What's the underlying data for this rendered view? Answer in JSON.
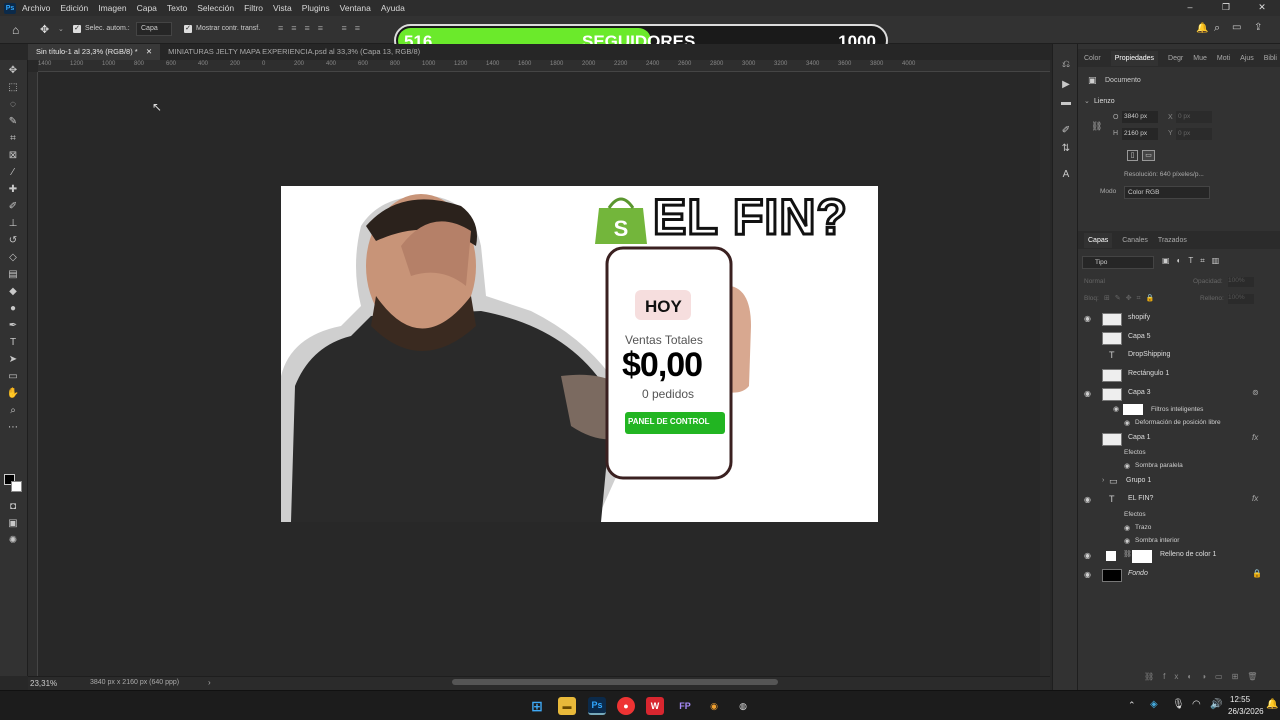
{
  "menu": [
    "Archivo",
    "Edición",
    "Imagen",
    "Capa",
    "Texto",
    "Selección",
    "Filtro",
    "Vista",
    "Plugins",
    "Ventana",
    "Ayuda"
  ],
  "options": {
    "auto_select_label": "Selec. autom.:",
    "layer_select": "Capa",
    "transform_label": "Mostrar contr. transf."
  },
  "tabs": [
    "Sin título-1 al 23,3% (RGB/8) *",
    "MINIATURAS JELTY MAPA EXPERIENCIA.psd al 33,3% (Capa 13, RGB/8)"
  ],
  "overlay": {
    "current": "516",
    "label": "SEGUIDORES",
    "goal": "1000",
    "progress": 0.516
  },
  "ruler_ticks": [
    "1400",
    "1200",
    "1000",
    "800",
    "600",
    "400",
    "200",
    "0",
    "200",
    "400",
    "600",
    "800",
    "1000",
    "1200",
    "1400",
    "1600",
    "1800",
    "2000",
    "2200",
    "2400",
    "2600",
    "2800",
    "3000",
    "3200",
    "3400",
    "3600",
    "3800",
    "4000"
  ],
  "thumbnail": {
    "headline": "EL FIN?",
    "phone_badge": "HOY",
    "phone_label": "Ventas Totales",
    "phone_amount": "$0,00",
    "phone_orders": "0 pedidos",
    "phone_button": "PANEL DE CONTROL"
  },
  "status": {
    "zoom": "23,31%",
    "doc_info": "3840 px x 2160 px (640 ppp)"
  },
  "properties": {
    "tabs": [
      "Color",
      "Propiedades",
      "Degr",
      "Mue",
      "Moti",
      "Ajus",
      "Bibli"
    ],
    "doc_label": "Documento",
    "section": "Lienzo",
    "w_label": "O",
    "w_value": "3840 px",
    "h_label": "H",
    "h_value": "2160 px",
    "x_label": "X",
    "x_value": "0 px",
    "y_label": "Y",
    "y_value": "0 px",
    "resolution": "Resolución: 640 píxeles/p...",
    "mode_label": "Modo",
    "mode_value": "Color RGB"
  },
  "layers_panel": {
    "tabs": [
      "Capas",
      "Canales",
      "Trazados"
    ],
    "filter": "Tipo",
    "blend": "Normal",
    "opacity_label": "Opacidad:",
    "opacity_value": "100%",
    "lock_label": "Bloq:",
    "fill_label": "Relleno:",
    "fill_value": "100%",
    "layers": [
      {
        "name": "shopify",
        "visible": true
      },
      {
        "name": "Capa 5",
        "visible": false
      },
      {
        "name": "DropShipping",
        "visible": false,
        "type": "text"
      },
      {
        "name": "Rectángulo 1",
        "visible": false
      },
      {
        "name": "Capa 3",
        "visible": true
      },
      {
        "name": "Capa 1",
        "visible": false
      },
      {
        "name": "Grupo 1",
        "visible": false,
        "type": "group"
      },
      {
        "name": "EL FIN?",
        "visible": true,
        "type": "text"
      },
      {
        "name": "Relleno de color 1",
        "visible": true
      },
      {
        "name": "Fondo",
        "visible": true
      }
    ],
    "sub": {
      "smart_filters": "Filtros inteligentes",
      "free_warp": "Deformación de posición libre",
      "effects": "Efectos",
      "drop_shadow": "Sombra paralela",
      "stroke": "Trazo",
      "inner_shadow": "Sombra interior"
    }
  },
  "taskbar": {
    "time": "12:55",
    "date": "26/3/2026"
  }
}
